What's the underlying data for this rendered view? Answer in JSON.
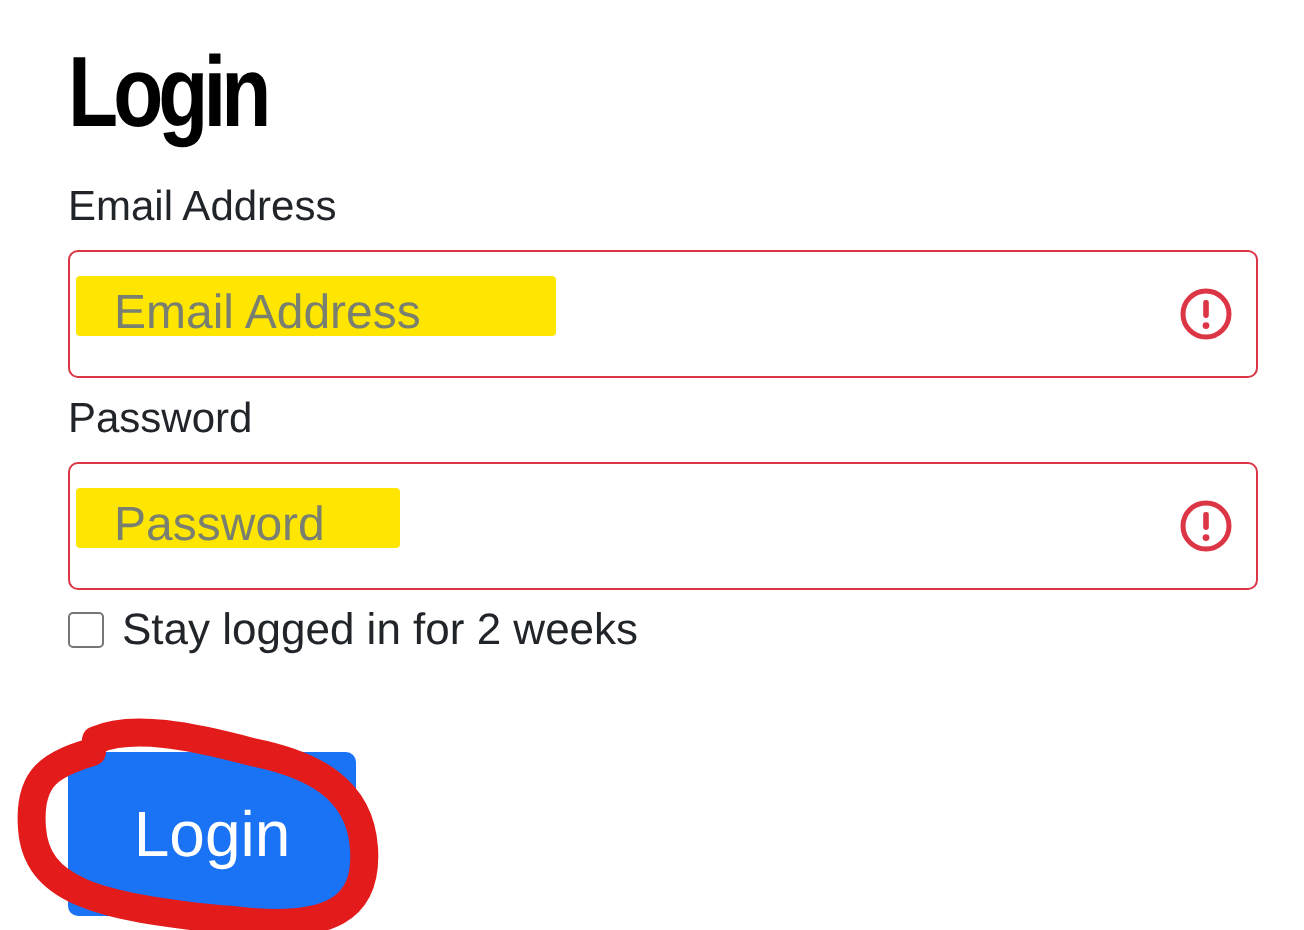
{
  "title": "Login",
  "fields": [
    {
      "label": "Email Address",
      "placeholder": "Email Address",
      "invalid": true,
      "highlighted": true
    },
    {
      "label": "Password",
      "placeholder": "Password",
      "invalid": true,
      "highlighted": true
    }
  ],
  "remember": {
    "label": "Stay logged in for 2 weeks",
    "checked": false
  },
  "button": {
    "label": "Login",
    "circled": true
  }
}
